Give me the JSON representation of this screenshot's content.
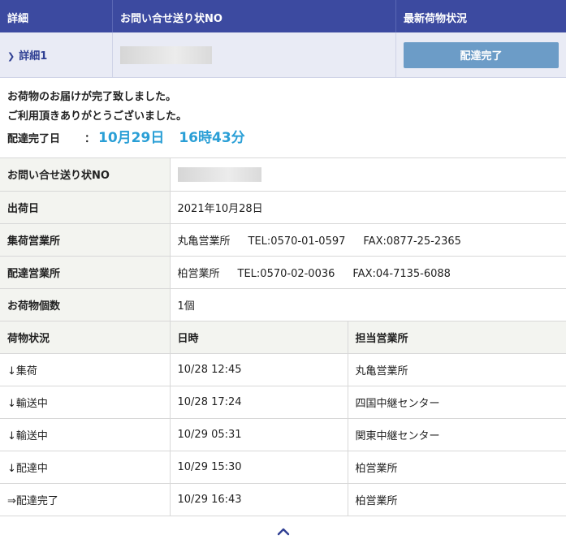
{
  "header": {
    "col_detail": "詳細",
    "col_tracking": "お問い合せ送り状NO",
    "col_status": "最新荷物状況"
  },
  "summary": {
    "detail_label": "詳細1",
    "status_button": "配達完了"
  },
  "message": {
    "line1": "お荷物のお届けが完了致しました。",
    "line2": "ご利用頂きありがとうございました。",
    "delivered_label": "配達完了日",
    "colon": "：",
    "delivered_date": "10月29日",
    "delivered_time": "16時43分"
  },
  "info": {
    "tracking_label": "お問い合せ送り状NO",
    "ship_date_label": "出荷日",
    "ship_date": "2021年10月28日",
    "pickup_office_label": "集荷営業所",
    "pickup_office_name": "丸亀営業所",
    "pickup_office_tel": "TEL:0570-01-0597",
    "pickup_office_fax": "FAX:0877-25-2365",
    "delivery_office_label": "配達営業所",
    "delivery_office_name": "柏営業所",
    "delivery_office_tel": "TEL:0570-02-0036",
    "delivery_office_fax": "FAX:04-7135-6088",
    "count_label": "お荷物個数",
    "count": "1個"
  },
  "history": {
    "headers": [
      "荷物状況",
      "日時",
      "担当営業所"
    ],
    "rows": [
      [
        "↓集荷",
        "10/28 12:45",
        "丸亀営業所"
      ],
      [
        "↓輸送中",
        "10/28 17:24",
        "四国中継センター"
      ],
      [
        "↓輸送中",
        "10/29 05:31",
        "関東中継センター"
      ],
      [
        "↓配達中",
        "10/29 15:30",
        "柏営業所"
      ],
      [
        "⇒配達完了",
        "10/29 16:43",
        "柏営業所"
      ]
    ]
  },
  "icons": {
    "detail_chevron": "chevron-down-icon",
    "scroll_top": "chevron-up-icon"
  }
}
